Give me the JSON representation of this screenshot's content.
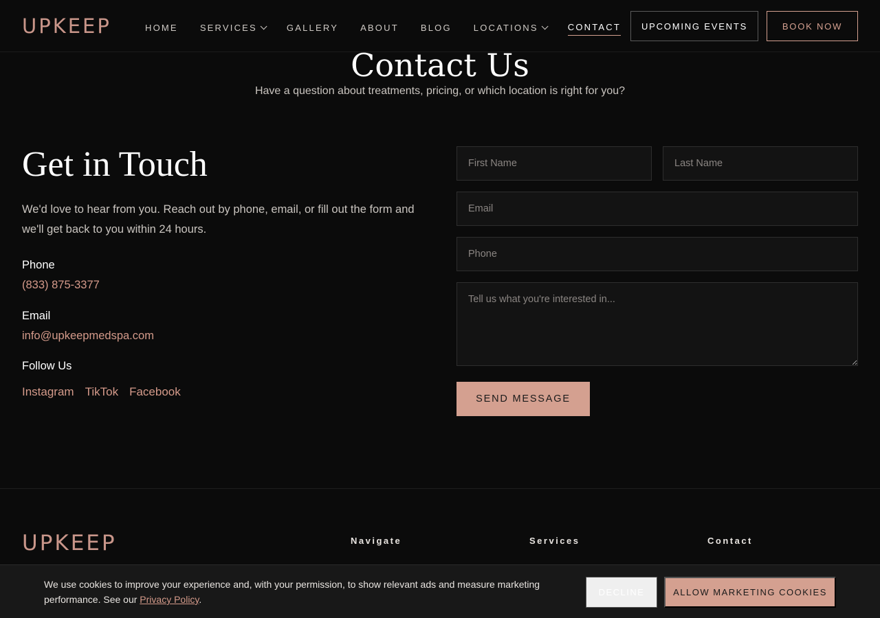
{
  "header": {
    "logo": "UPKEEP",
    "nav": [
      {
        "label": "Home",
        "dropdown": false
      },
      {
        "label": "Services",
        "dropdown": true
      },
      {
        "label": "Gallery",
        "dropdown": false
      },
      {
        "label": "About",
        "dropdown": false
      },
      {
        "label": "Blog",
        "dropdown": false
      },
      {
        "label": "Locations",
        "dropdown": true
      },
      {
        "label": "Contact",
        "dropdown": false,
        "active": true
      }
    ],
    "events_label": "Upcoming Events",
    "book_label": "Book Now"
  },
  "hero": {
    "title": "Contact Us",
    "subtitle": "Have a question about treatments, pricing, or which location is right for you?"
  },
  "info": {
    "title": "Get in Touch",
    "body": "We'd love to hear from you. Reach out by phone, email, or fill out the form and we'll get back to you within 24 hours.",
    "phone_label": "Phone",
    "phone": "(833) 875-3377",
    "email_label": "Email",
    "email": "info@upkeepmedspa.com",
    "follow_label": "Follow Us",
    "socials": [
      "Instagram",
      "TikTok",
      "Facebook"
    ]
  },
  "form": {
    "first_name_placeholder": "First Name",
    "last_name_placeholder": "Last Name",
    "email_placeholder": "Email",
    "phone_placeholder": "Phone",
    "message_placeholder": "Tell us what you're interested in...",
    "submit_label": "Send Message"
  },
  "footer": {
    "logo": "UPKEEP",
    "col1": "Navigate",
    "col2": "Services",
    "col3": "Contact"
  },
  "cookie": {
    "text": "We use cookies to improve your experience and, with your permission, to show relevant ads and measure marketing performance. See our ",
    "policy_link": "Privacy Policy",
    "after": ".",
    "decline_label": "Decline",
    "allow_label": "Allow Marketing Cookies"
  },
  "colors": {
    "accent": "#d4a090",
    "background": "#0b0b0b"
  }
}
